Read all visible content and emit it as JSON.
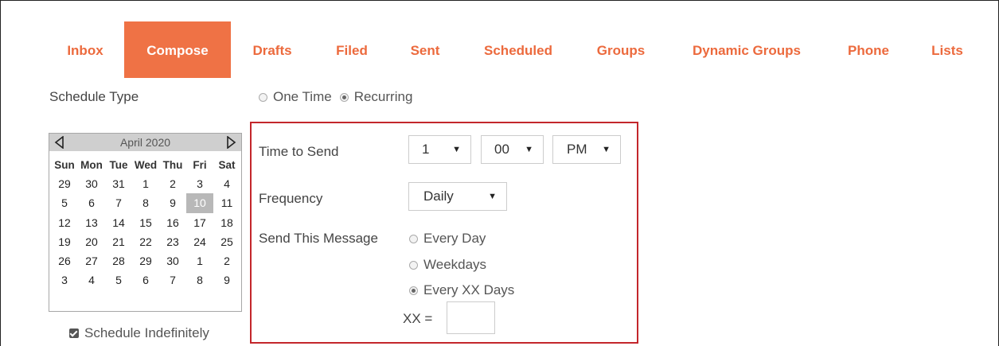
{
  "tabs": [
    {
      "label": "Inbox",
      "active": false
    },
    {
      "label": "Compose",
      "active": true
    },
    {
      "label": "Drafts",
      "active": false
    },
    {
      "label": "Filed",
      "active": false
    },
    {
      "label": "Sent",
      "active": false
    },
    {
      "label": "Scheduled",
      "active": false
    },
    {
      "label": "Groups",
      "active": false
    },
    {
      "label": "Dynamic Groups",
      "active": false
    },
    {
      "label": "Phone",
      "active": false
    },
    {
      "label": "Lists",
      "active": false
    }
  ],
  "schedule_type": {
    "label": "Schedule Type",
    "options": [
      "One Time",
      "Recurring"
    ],
    "selected": "Recurring"
  },
  "calendar": {
    "month_label": "April 2020",
    "weekdays": [
      "Sun",
      "Mon",
      "Tue",
      "Wed",
      "Thu",
      "Fri",
      "Sat"
    ],
    "weeks": [
      [
        "29",
        "30",
        "31",
        "1",
        "2",
        "3",
        "4"
      ],
      [
        "5",
        "6",
        "7",
        "8",
        "9",
        "10",
        "11"
      ],
      [
        "12",
        "13",
        "14",
        "15",
        "16",
        "17",
        "18"
      ],
      [
        "19",
        "20",
        "21",
        "22",
        "23",
        "24",
        "25"
      ],
      [
        "26",
        "27",
        "28",
        "29",
        "30",
        "1",
        "2"
      ],
      [
        "3",
        "4",
        "5",
        "6",
        "7",
        "8",
        "9"
      ]
    ],
    "selected_day": "10"
  },
  "schedule_indefinitely": {
    "label": "Schedule Indefinitely",
    "checked": true
  },
  "panel": {
    "time_label": "Time to Send",
    "hour": "1",
    "minute": "00",
    "ampm": "PM",
    "frequency_label": "Frequency",
    "frequency": "Daily",
    "send_label": "Send This Message",
    "send_options": [
      "Every Day",
      "Weekdays",
      "Every XX Days"
    ],
    "send_selected": "Every XX Days",
    "xx_label": "XX =",
    "xx_value": ""
  },
  "colors": {
    "accent": "#ef7245",
    "tab_text": "#ec6a3d",
    "panel_border": "#c3262b"
  }
}
